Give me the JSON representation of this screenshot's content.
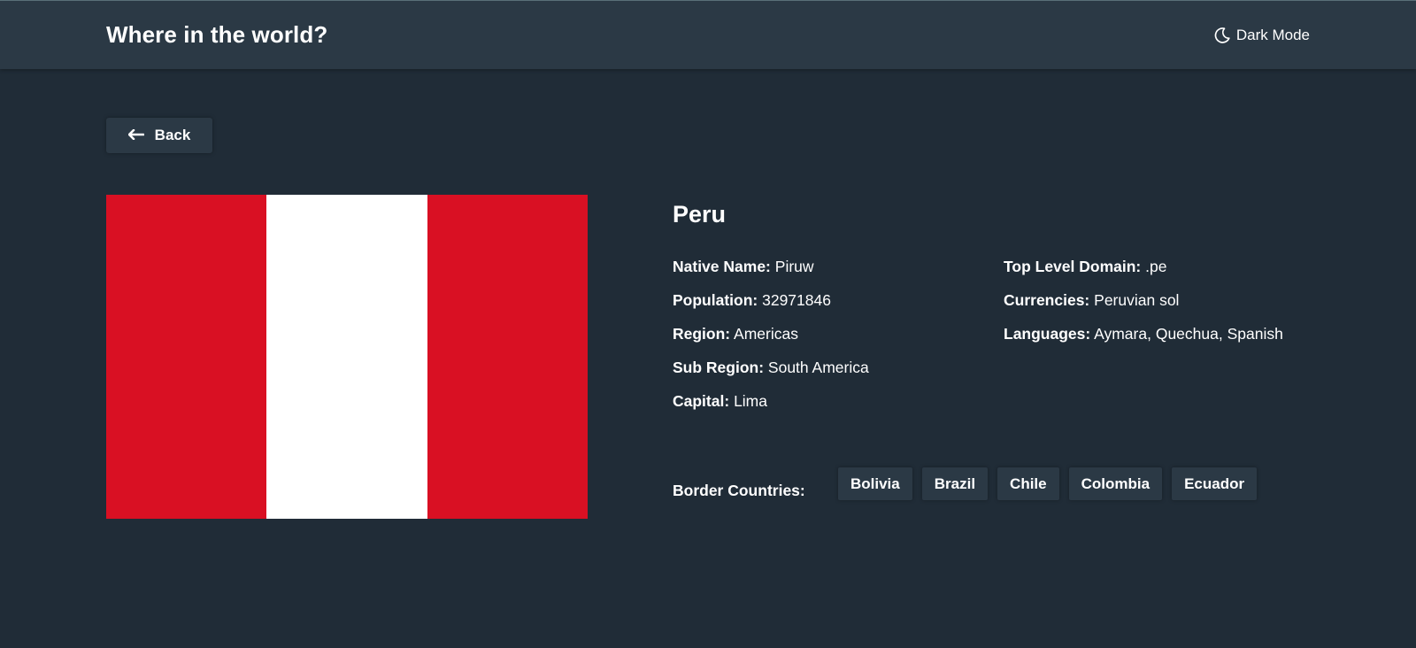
{
  "header": {
    "title": "Where in the world?",
    "theme_toggle_label": "Dark Mode"
  },
  "back_button_label": "Back",
  "colors": {
    "background": "#202c37",
    "elements": "#2b3945",
    "text": "#ffffff",
    "flag_red": "#d91023",
    "flag_white": "#ffffff"
  },
  "icons": {
    "theme_toggle": "moon-icon",
    "back": "arrow-left-icon"
  },
  "country": {
    "name": "Peru",
    "details_left": [
      {
        "label": "Native Name:",
        "value": "Piruw"
      },
      {
        "label": "Population:",
        "value": "32971846"
      },
      {
        "label": "Region:",
        "value": "Americas"
      },
      {
        "label": "Sub Region:",
        "value": "South America"
      },
      {
        "label": "Capital:",
        "value": "Lima"
      }
    ],
    "details_right": [
      {
        "label": "Top Level Domain:",
        "value": ".pe"
      },
      {
        "label": "Currencies:",
        "value": "Peruvian sol"
      },
      {
        "label": "Languages:",
        "value": "Aymara, Quechua, Spanish"
      }
    ],
    "border_label": "Border Countries:",
    "borders": [
      "Bolivia",
      "Brazil",
      "Chile",
      "Colombia",
      "Ecuador"
    ]
  }
}
